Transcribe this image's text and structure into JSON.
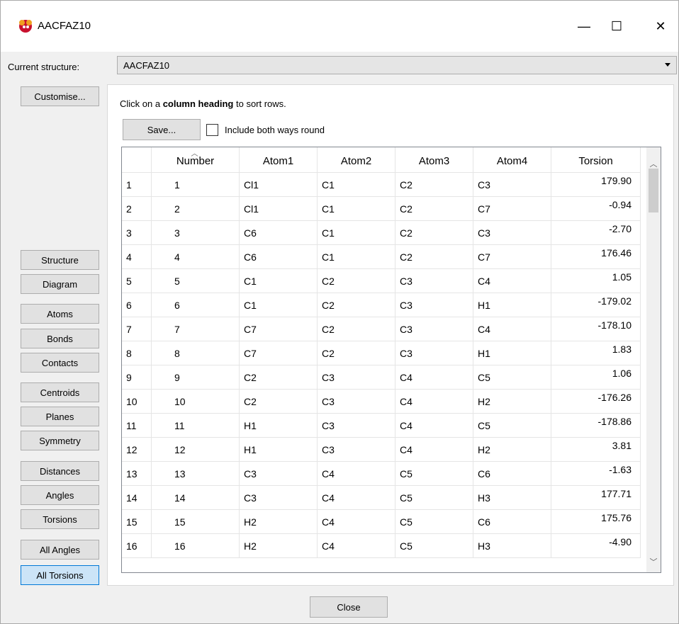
{
  "window": {
    "title": "AACFAZ10",
    "minimize_glyph": "—",
    "maximize_glyph": "☐",
    "close_glyph": "✕"
  },
  "structure": {
    "label": "Current structure:",
    "value": "AACFAZ10"
  },
  "sidebar": {
    "customise": "Customise...",
    "structure": "Structure",
    "diagram": "Diagram",
    "atoms": "Atoms",
    "bonds": "Bonds",
    "contacts": "Contacts",
    "centroids": "Centroids",
    "planes": "Planes",
    "symmetry": "Symmetry",
    "distances": "Distances",
    "angles": "Angles",
    "torsions": "Torsions",
    "all_angles": "All Angles",
    "all_torsions": "All Torsions",
    "active": "All Torsions"
  },
  "panel": {
    "hint_pre": "Click on a ",
    "hint_bold": "column heading",
    "hint_post": " to sort rows.",
    "save_label": "Save...",
    "include_label": "Include both ways round",
    "include_checked": false
  },
  "table": {
    "columns": [
      "Number",
      "Atom1",
      "Atom2",
      "Atom3",
      "Atom4",
      "Torsion"
    ],
    "sort_column": "Number",
    "rows": [
      {
        "idx": "1",
        "number": "1",
        "a1": "Cl1",
        "a2": "C1",
        "a3": "C2",
        "a4": "C3",
        "torsion": "179.90"
      },
      {
        "idx": "2",
        "number": "2",
        "a1": "Cl1",
        "a2": "C1",
        "a3": "C2",
        "a4": "C7",
        "torsion": "-0.94"
      },
      {
        "idx": "3",
        "number": "3",
        "a1": "C6",
        "a2": "C1",
        "a3": "C2",
        "a4": "C3",
        "torsion": "-2.70"
      },
      {
        "idx": "4",
        "number": "4",
        "a1": "C6",
        "a2": "C1",
        "a3": "C2",
        "a4": "C7",
        "torsion": "176.46"
      },
      {
        "idx": "5",
        "number": "5",
        "a1": "C1",
        "a2": "C2",
        "a3": "C3",
        "a4": "C4",
        "torsion": "1.05"
      },
      {
        "idx": "6",
        "number": "6",
        "a1": "C1",
        "a2": "C2",
        "a3": "C3",
        "a4": "H1",
        "torsion": "-179.02"
      },
      {
        "idx": "7",
        "number": "7",
        "a1": "C7",
        "a2": "C2",
        "a3": "C3",
        "a4": "C4",
        "torsion": "-178.10"
      },
      {
        "idx": "8",
        "number": "8",
        "a1": "C7",
        "a2": "C2",
        "a3": "C3",
        "a4": "H1",
        "torsion": "1.83"
      },
      {
        "idx": "9",
        "number": "9",
        "a1": "C2",
        "a2": "C3",
        "a3": "C4",
        "a4": "C5",
        "torsion": "1.06"
      },
      {
        "idx": "10",
        "number": "10",
        "a1": "C2",
        "a2": "C3",
        "a3": "C4",
        "a4": "H2",
        "torsion": "-176.26"
      },
      {
        "idx": "11",
        "number": "11",
        "a1": "H1",
        "a2": "C3",
        "a3": "C4",
        "a4": "C5",
        "torsion": "-178.86"
      },
      {
        "idx": "12",
        "number": "12",
        "a1": "H1",
        "a2": "C3",
        "a3": "C4",
        "a4": "H2",
        "torsion": "3.81"
      },
      {
        "idx": "13",
        "number": "13",
        "a1": "C3",
        "a2": "C4",
        "a3": "C5",
        "a4": "C6",
        "torsion": "-1.63"
      },
      {
        "idx": "14",
        "number": "14",
        "a1": "C3",
        "a2": "C4",
        "a3": "C5",
        "a4": "H3",
        "torsion": "177.71"
      },
      {
        "idx": "15",
        "number": "15",
        "a1": "H2",
        "a2": "C4",
        "a3": "C5",
        "a4": "C6",
        "torsion": "175.76"
      },
      {
        "idx": "16",
        "number": "16",
        "a1": "H2",
        "a2": "C4",
        "a3": "C5",
        "a4": "H3",
        "torsion": "-4.90"
      }
    ]
  },
  "footer": {
    "close_label": "Close"
  }
}
